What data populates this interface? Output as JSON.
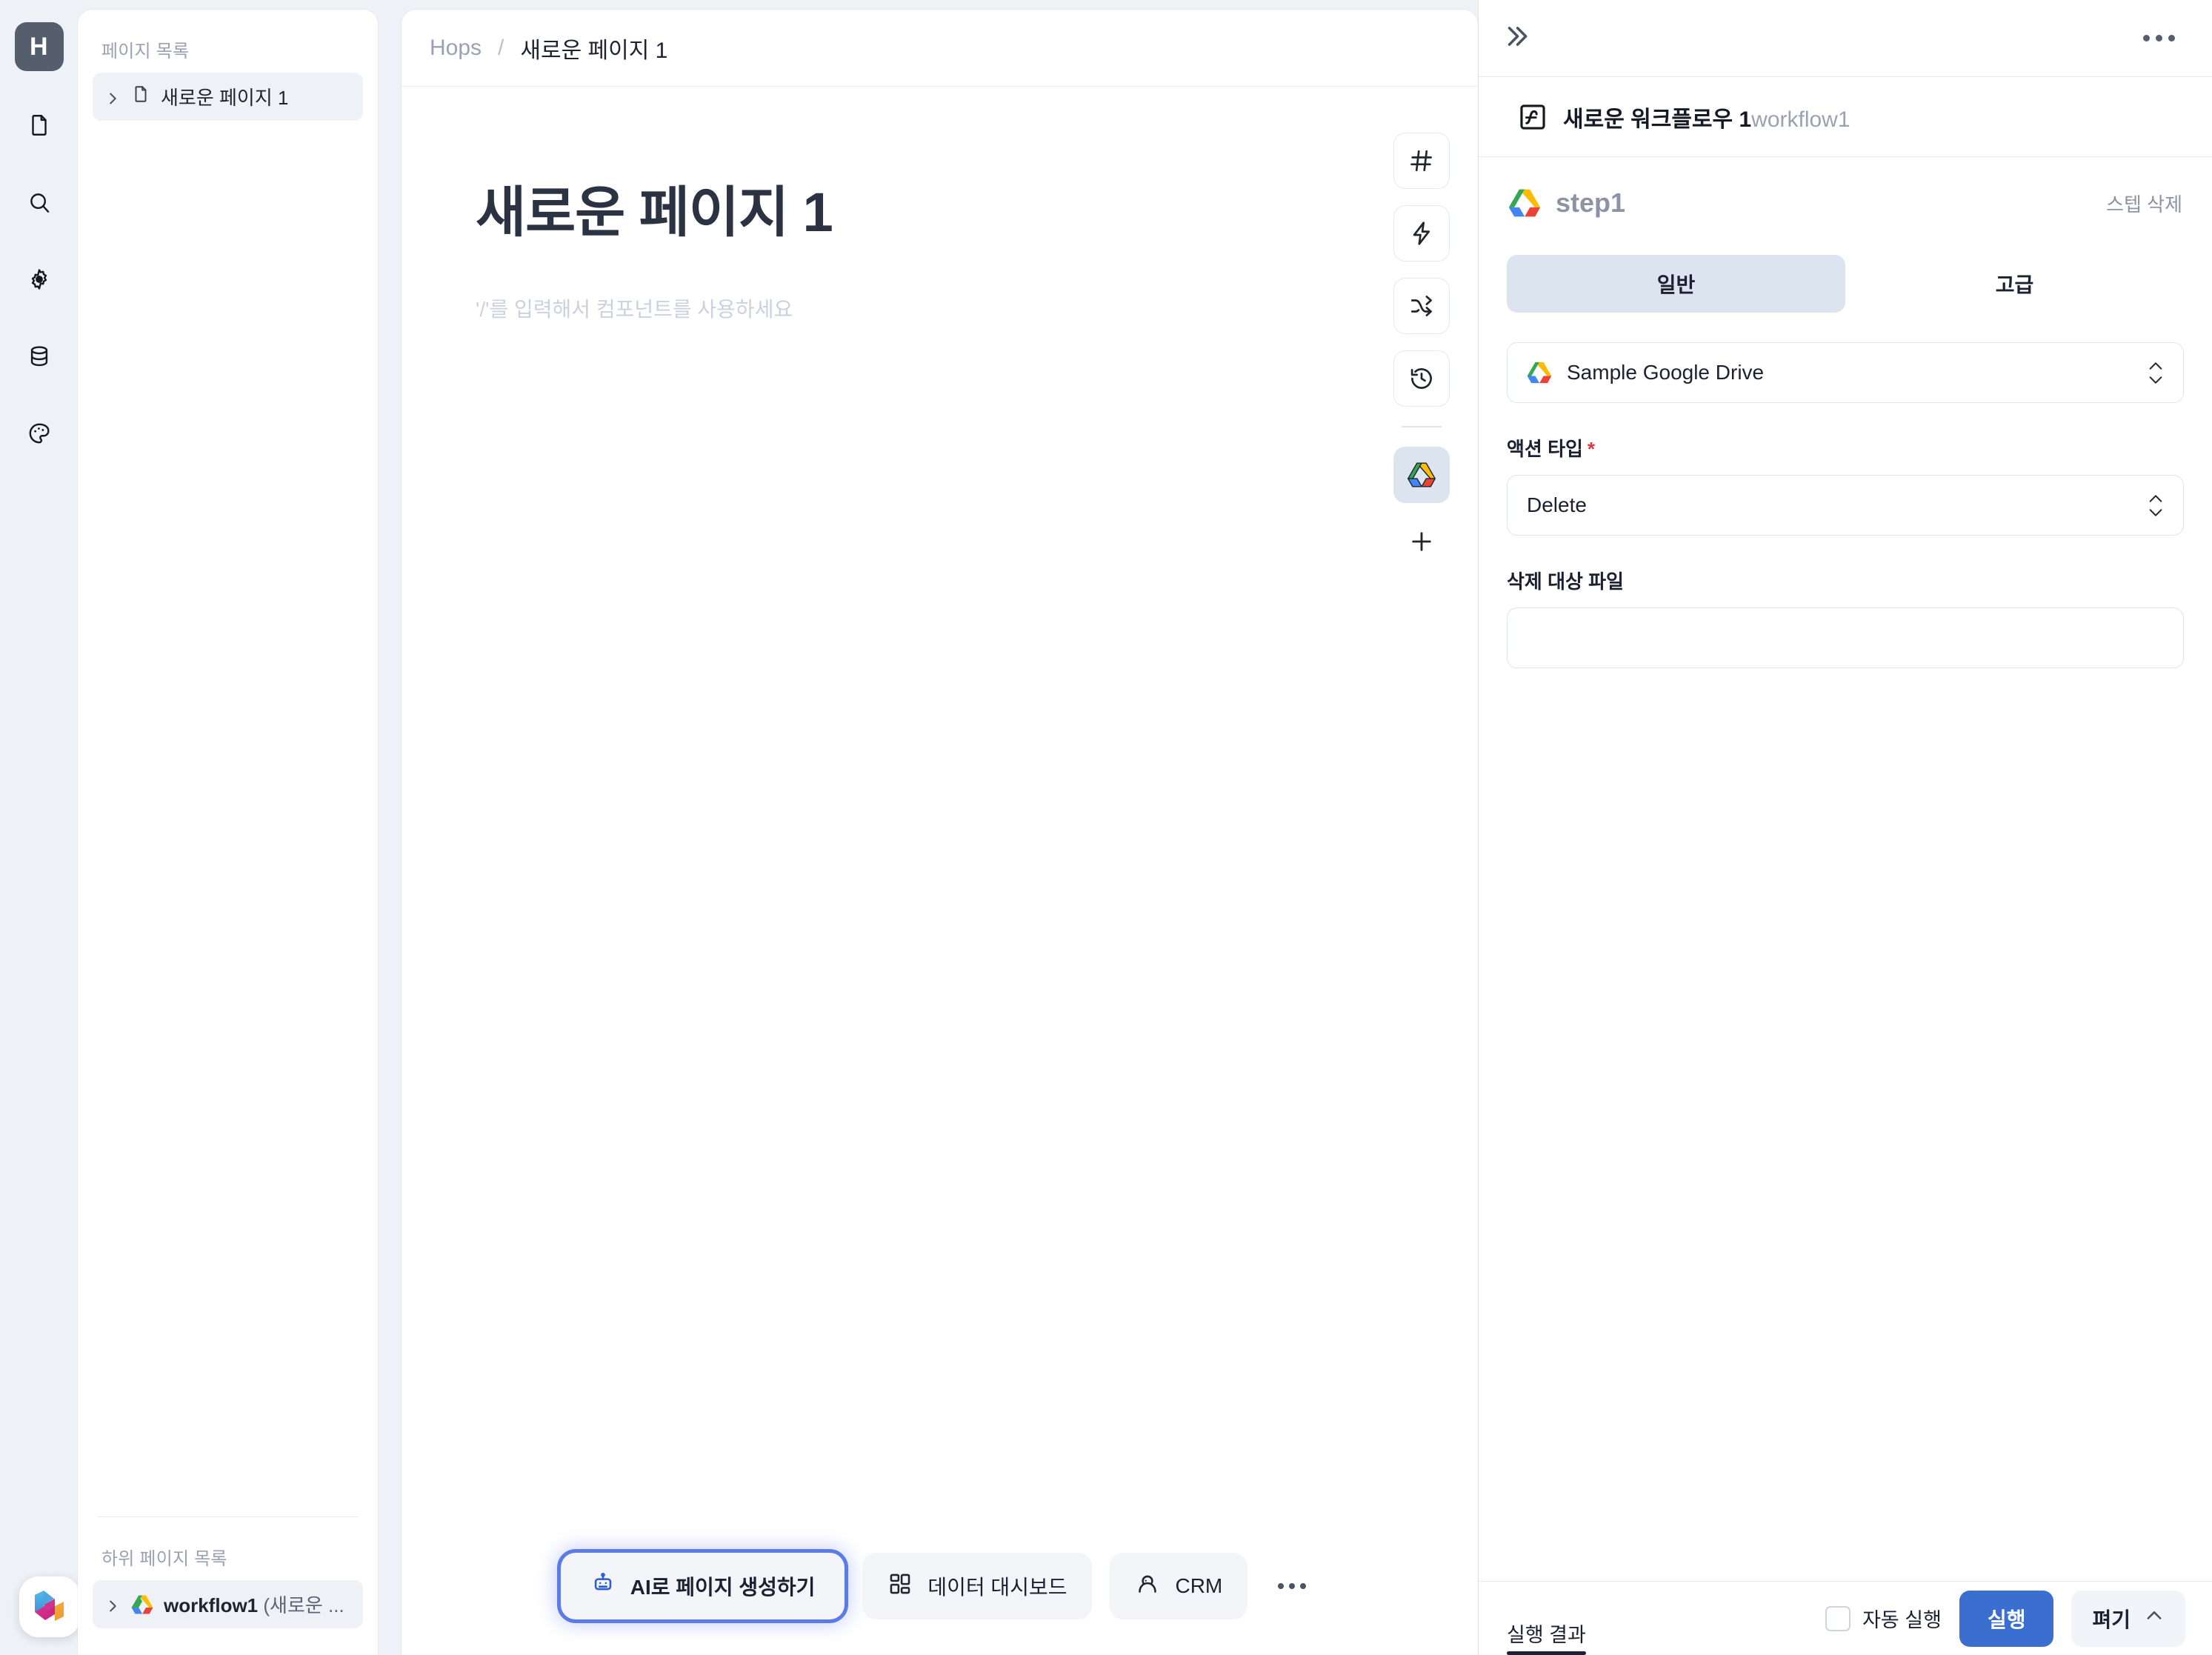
{
  "app": {
    "logo_letter": "H",
    "brand_badge_icon": "hops-logo-icon"
  },
  "rail": {
    "items": [
      {
        "name": "document-icon",
        "label": "문서"
      },
      {
        "name": "search-icon",
        "label": "검색"
      },
      {
        "name": "gear-icon",
        "label": "설정"
      },
      {
        "name": "database-icon",
        "label": "데이터"
      },
      {
        "name": "palette-icon",
        "label": "테마"
      }
    ]
  },
  "sidebar": {
    "pages_label": "페이지 목록",
    "pages": [
      {
        "label": "새로운 페이지 1",
        "icon": "document-icon",
        "active": true
      }
    ],
    "subpages_label": "하위 페이지 목록",
    "subpages": [
      {
        "label": "workflow1 ",
        "suffix": "(새로운 ...",
        "icon": "google-drive-icon",
        "active": true
      }
    ]
  },
  "breadcrumb": {
    "root": "Hops",
    "separator": "/",
    "current": "새로운 페이지 1"
  },
  "canvas": {
    "title": "새로운 페이지 1",
    "placeholder": "'/'를 입력해서 컴포넌트를 사용하세요",
    "tools": [
      {
        "name": "hash-icon",
        "label": "#"
      },
      {
        "name": "lightning-icon",
        "label": "액션"
      },
      {
        "name": "branch-icon",
        "label": "분기"
      },
      {
        "name": "history-icon",
        "label": "기록"
      }
    ],
    "selected_tool": {
      "name": "google-drive-icon",
      "label": "Google Drive"
    },
    "add_tool": {
      "name": "plus-icon",
      "label": "추가"
    }
  },
  "bottom_bar": {
    "buttons": [
      {
        "label": "AI로 페이지 생성하기",
        "icon": "robot-icon",
        "highlighted": true
      },
      {
        "label": "데이터 대시보드",
        "icon": "dashboard-icon",
        "highlighted": false
      },
      {
        "label": "CRM",
        "icon": "crm-icon",
        "highlighted": false
      }
    ],
    "more_label": "더보기"
  },
  "right_panel": {
    "collapse_icon": "chevron-double-right-icon",
    "more_icon": "more-horizontal-icon",
    "workflow": {
      "icon": "workflow-icon",
      "name": "새로운 워크플로우 1",
      "slug": "workflow1"
    },
    "step": {
      "icon": "google-drive-icon",
      "name": "step1",
      "delete_label": "스텝 삭제"
    },
    "tabs": [
      {
        "label": "일반",
        "active": true
      },
      {
        "label": "고급",
        "active": false
      }
    ],
    "connection": {
      "icon": "google-drive-icon",
      "value": "Sample Google Drive"
    },
    "fields": [
      {
        "label": "액션 타입",
        "required": true,
        "type": "select",
        "value": "Delete"
      },
      {
        "label": "삭제 대상 파일",
        "required": false,
        "type": "text",
        "value": "",
        "placeholder": ""
      }
    ],
    "footer": {
      "result_tab": "실행 결과",
      "auto_run_label": "자동 실행",
      "auto_run_checked": false,
      "run_label": "실행",
      "expand_label": "펴기"
    }
  },
  "colors": {
    "page_bg": "#eef1f6",
    "card_bg": "#ffffff",
    "accent_blue": "#3a6fd0",
    "ai_glow": "#5b7ce6",
    "required_red": "#d93a3a",
    "muted_text": "#9aa2b1",
    "tab_active_bg": "#dce4ef"
  }
}
